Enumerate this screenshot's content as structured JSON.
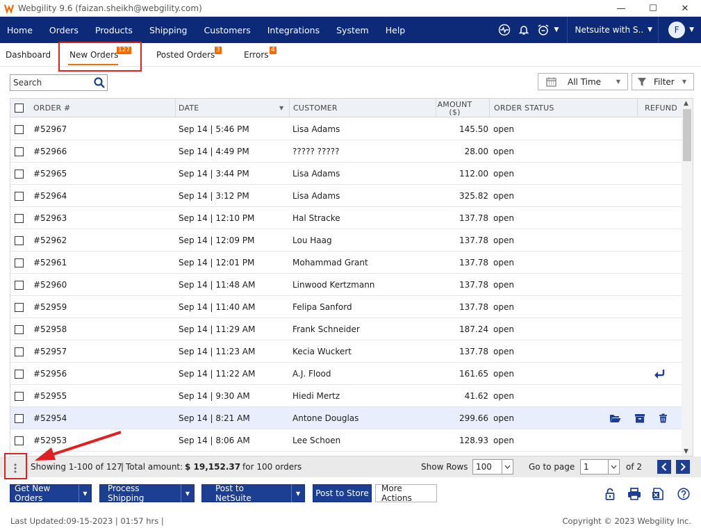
{
  "window": {
    "title": "Webgility 9.6 (faizan.sheikh@webgility.com)",
    "controls": [
      "—",
      "☐",
      "✕"
    ]
  },
  "nav": {
    "items": [
      "Home",
      "Orders",
      "Products",
      "Shipping",
      "Customers",
      "Integrations",
      "System",
      "Help"
    ],
    "store": "Netsuite with S..",
    "avatar": "F"
  },
  "tabs": [
    {
      "label": "Dashboard",
      "badge": ""
    },
    {
      "label": "New Orders",
      "badge": "127"
    },
    {
      "label": "Posted Orders",
      "badge": "3"
    },
    {
      "label": "Errors",
      "badge": "4"
    }
  ],
  "toolbar": {
    "search_placeholder": "Search",
    "time_filter": "All Time",
    "filter_label": "Filter"
  },
  "grid": {
    "headers": {
      "order": "ORDER #",
      "date": "DATE",
      "customer": "CUSTOMER",
      "amount": "AMOUNT",
      "amount_unit": "($)",
      "status": "ORDER STATUS",
      "refund": "REFUND"
    },
    "rows": [
      {
        "order": "#52967",
        "date": "Sep 14 | 5:46 PM",
        "customer": "Lisa Adams",
        "amount": "145.50",
        "status": "open"
      },
      {
        "order": "#52966",
        "date": "Sep 14 | 4:49 PM",
        "customer": "????? ?????",
        "amount": "28.00",
        "status": "open"
      },
      {
        "order": "#52965",
        "date": "Sep 14 | 3:44 PM",
        "customer": "Lisa Adams",
        "amount": "112.00",
        "status": "open"
      },
      {
        "order": "#52964",
        "date": "Sep 14 | 3:12 PM",
        "customer": "Lisa Adams",
        "amount": "325.82",
        "status": "open"
      },
      {
        "order": "#52963",
        "date": "Sep 14 | 12:10 PM",
        "customer": "Hal Stracke",
        "amount": "137.78",
        "status": "open"
      },
      {
        "order": "#52962",
        "date": "Sep 14 | 12:09 PM",
        "customer": "Lou Haag",
        "amount": "137.78",
        "status": "open"
      },
      {
        "order": "#52961",
        "date": "Sep 14 | 12:01 PM",
        "customer": "Mohammad Grant",
        "amount": "137.78",
        "status": "open"
      },
      {
        "order": "#52960",
        "date": "Sep 14 | 11:48 AM",
        "customer": "Linwood Kertzmann",
        "amount": "137.78",
        "status": "open"
      },
      {
        "order": "#52959",
        "date": "Sep 14 | 11:40 AM",
        "customer": "Felipa Sanford",
        "amount": "137.78",
        "status": "open"
      },
      {
        "order": "#52958",
        "date": "Sep 14 | 11:29 AM",
        "customer": "Frank Schneider",
        "amount": "187.24",
        "status": "open"
      },
      {
        "order": "#52957",
        "date": "Sep 14 | 11:23 AM",
        "customer": "Kecia Wuckert",
        "amount": "137.78",
        "status": "open"
      },
      {
        "order": "#52956",
        "date": "Sep 14 | 11:22 AM",
        "customer": "A.J. Flood",
        "amount": "161.65",
        "status": "open",
        "refund_icon": "reply-arrow-icon"
      },
      {
        "order": "#52955",
        "date": "Sep 14 | 9:30 AM",
        "customer": "Hiedi Mertz",
        "amount": "41.62",
        "status": "open"
      },
      {
        "order": "#52954",
        "date": "Sep 14 | 8:21 AM",
        "customer": "Antone Douglas",
        "amount": "299.66",
        "status": "open",
        "selected": true,
        "row_icons": [
          "folder-open-icon",
          "archive-icon",
          "trash-icon"
        ]
      },
      {
        "order": "#52953",
        "date": "Sep 14 | 8:06 AM",
        "customer": "Lee Schoen",
        "amount": "128.93",
        "status": "open"
      }
    ]
  },
  "status": {
    "showing": "Showing 1-100 of 127",
    "total_label": "Total amount:",
    "total_value": "$ 19,152.37",
    "for_orders": "for 100 orders",
    "show_rows_label": "Show Rows",
    "show_rows_value": "100",
    "go_to_page_label": "Go to page",
    "page_value": "1",
    "of_pages": "of 2"
  },
  "actions": {
    "get_new_orders": "Get New Orders",
    "process_shipping": "Process Shipping",
    "post_to_netsuite": "Post to NetSuite",
    "post_to_store": "Post to Store",
    "more_actions": "More Actions"
  },
  "footer": {
    "last_updated": "Last Updated:09-15-2023 | 01:57 hrs |",
    "copyright": "Copyright © 2023 Webgility Inc."
  },
  "colors": {
    "nav_bg": "#0d2a78",
    "accent": "#ef6c00",
    "button_blue": "#1c3f94",
    "highlight_red": "#e02020"
  }
}
